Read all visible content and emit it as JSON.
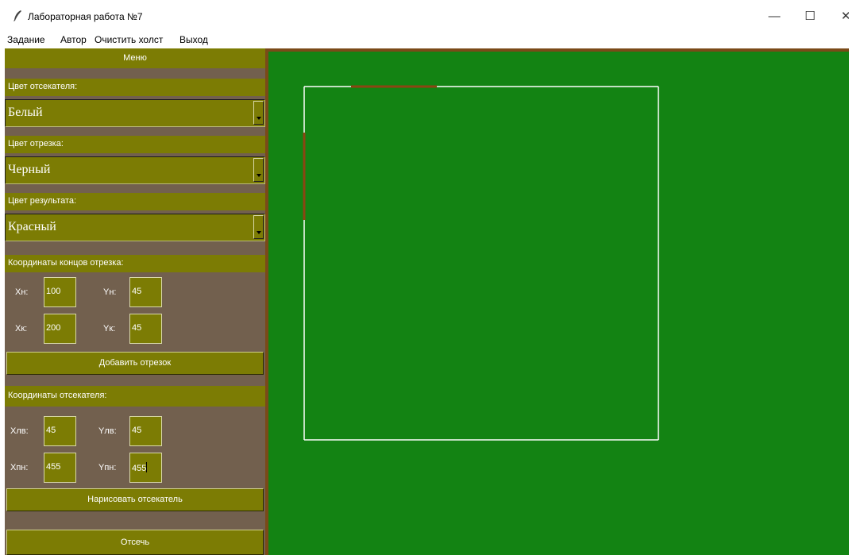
{
  "window": {
    "title": "Лабораторная работа №7",
    "controls": {
      "minimize": "—",
      "maximize": "☐",
      "close": "✕"
    }
  },
  "menubar": {
    "items": [
      "Задание",
      "Автор",
      "Очистить холст",
      "Выход"
    ]
  },
  "panel": {
    "header": "Меню",
    "clipper_color_label": "Цвет отсекателя:",
    "clipper_color_value": "Белый",
    "segment_color_label": "Цвет отрезка:",
    "segment_color_value": "Черный",
    "result_color_label": "Цвет результата:",
    "result_color_value": "Красный",
    "segment_coords_label": "Координаты концов отрезка:",
    "segment": {
      "xn_label": "Xн:",
      "xn_value": "100",
      "yn_label": "Yн:",
      "yn_value": "45",
      "xk_label": "Xк:",
      "xk_value": "200",
      "yk_label": "Yк:",
      "yk_value": "45"
    },
    "add_segment_button": "Добавить отрезок",
    "clipper_coords_label": "Координаты отсекателя:",
    "clipper": {
      "xlv_label": "Xлв:",
      "xlv_value": "45",
      "ylv_label": "Yлв:",
      "ylv_value": "45",
      "xpn_label": "Xпн:",
      "xpn_value": "455",
      "ypn_label": "Yпн:",
      "ypn_value": "455"
    },
    "draw_clipper_button": "Нарисовать отсекатель",
    "clip_button": "Отсечь"
  },
  "colors": {
    "panel_bg": "#72604e",
    "widget_bg": "#7c7c04",
    "canvas_bg": "#138313",
    "canvas_border": "#7a4a18",
    "clipper_line": "#ffffff",
    "result_line": "#8b4513"
  },
  "icons": {
    "app": "feather-icon"
  }
}
